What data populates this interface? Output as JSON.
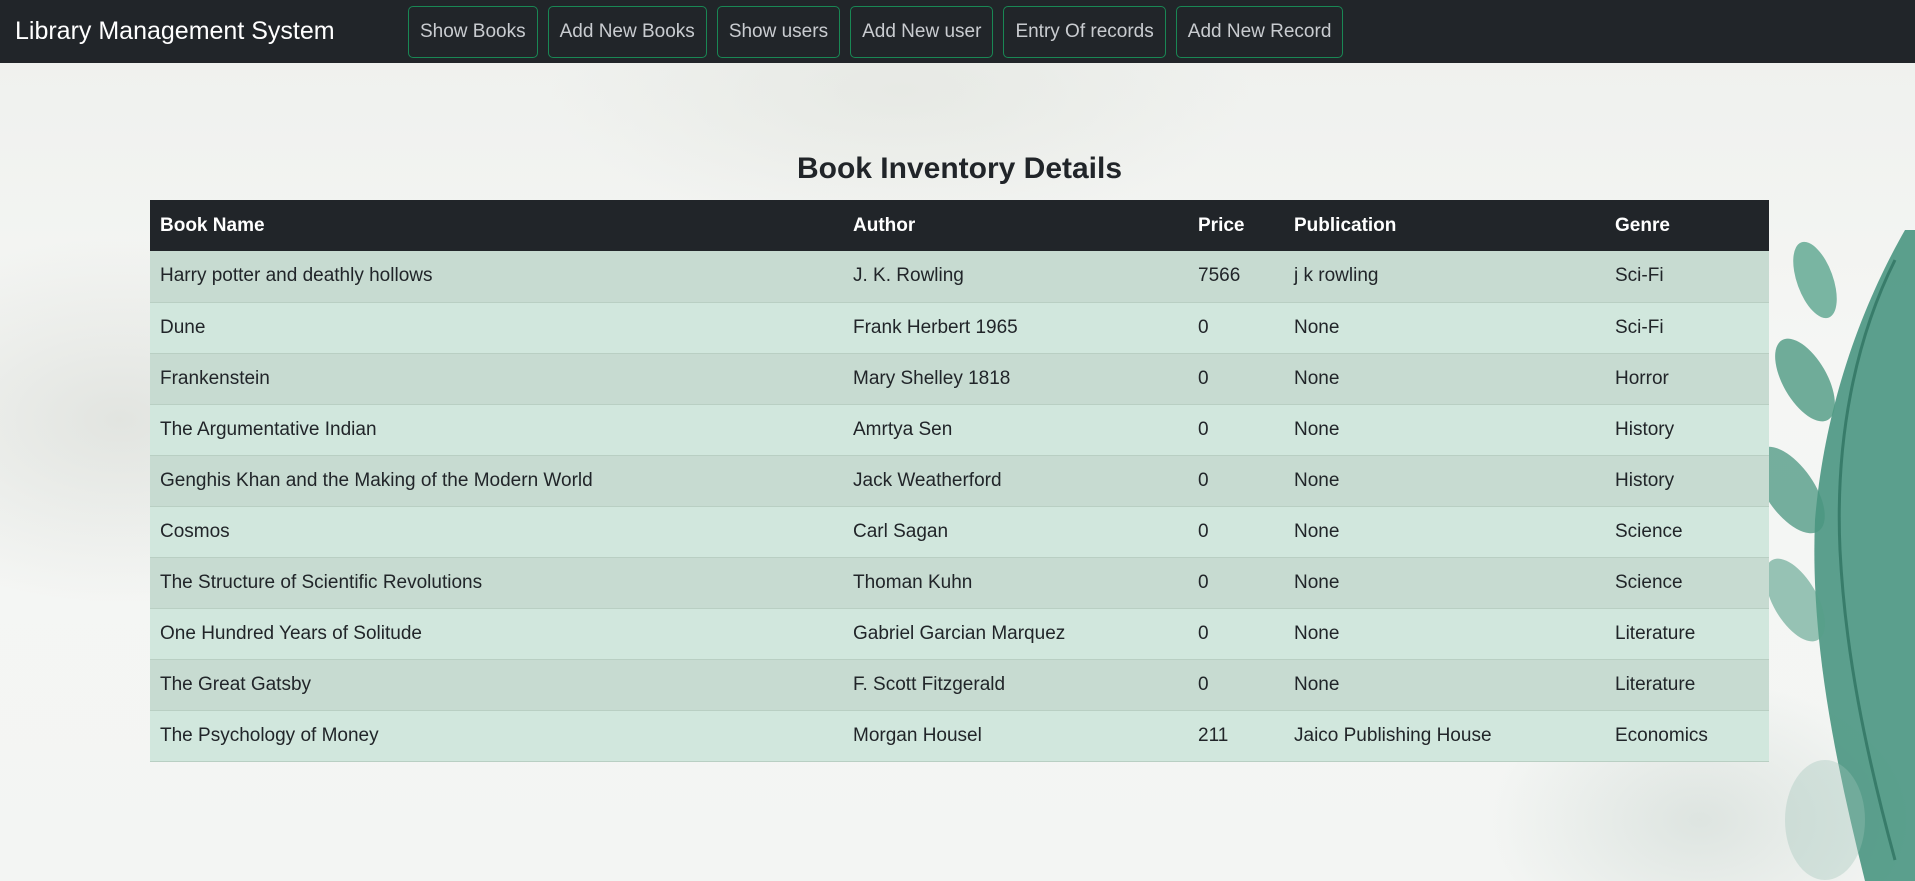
{
  "app": {
    "brand": "Library Management System"
  },
  "nav": {
    "buttons": [
      {
        "label": "Show Books"
      },
      {
        "label": "Add New Books"
      },
      {
        "label": "Show users"
      },
      {
        "label": "Add New user"
      },
      {
        "label": "Entry Of records"
      },
      {
        "label": "Add New Record"
      }
    ]
  },
  "main": {
    "title": "Book Inventory Details",
    "table": {
      "headers": [
        "Book Name",
        "Author",
        "Price",
        "Publication",
        "Genre"
      ],
      "rows": [
        [
          "Harry potter and deathly hollows",
          "J. K. Rowling",
          "7566",
          "j k rowling",
          "Sci-Fi"
        ],
        [
          "Dune",
          "Frank Herbert 1965",
          "0",
          "None",
          "Sci-Fi"
        ],
        [
          "Frankenstein",
          "Mary Shelley 1818",
          "0",
          "None",
          "Horror"
        ],
        [
          "The Argumentative Indian",
          "Amrtya Sen",
          "0",
          "None",
          "History"
        ],
        [
          "Genghis Khan and the Making of the Modern World",
          "Jack Weatherford",
          "0",
          "None",
          "History"
        ],
        [
          "Cosmos",
          "Carl Sagan",
          "0",
          "None",
          "Science"
        ],
        [
          "The Structure of Scientific Revolutions",
          "Thoman Kuhn",
          "0",
          "None",
          "Science"
        ],
        [
          "One Hundred Years of Solitude",
          "Gabriel Garcian Marquez",
          "0",
          "None",
          "Literature"
        ],
        [
          "The Great Gatsby",
          "F. Scott Fitzgerald",
          "0",
          "None",
          "Literature"
        ],
        [
          "The Psychology of Money",
          "Morgan Housel",
          "211",
          "Jaico Publishing House",
          "Economics"
        ]
      ]
    }
  },
  "colors": {
    "navbar_bg": "#212529",
    "button_border": "#198754",
    "row_odd": "#c7dbd1",
    "row_even": "#d1e7dd"
  }
}
